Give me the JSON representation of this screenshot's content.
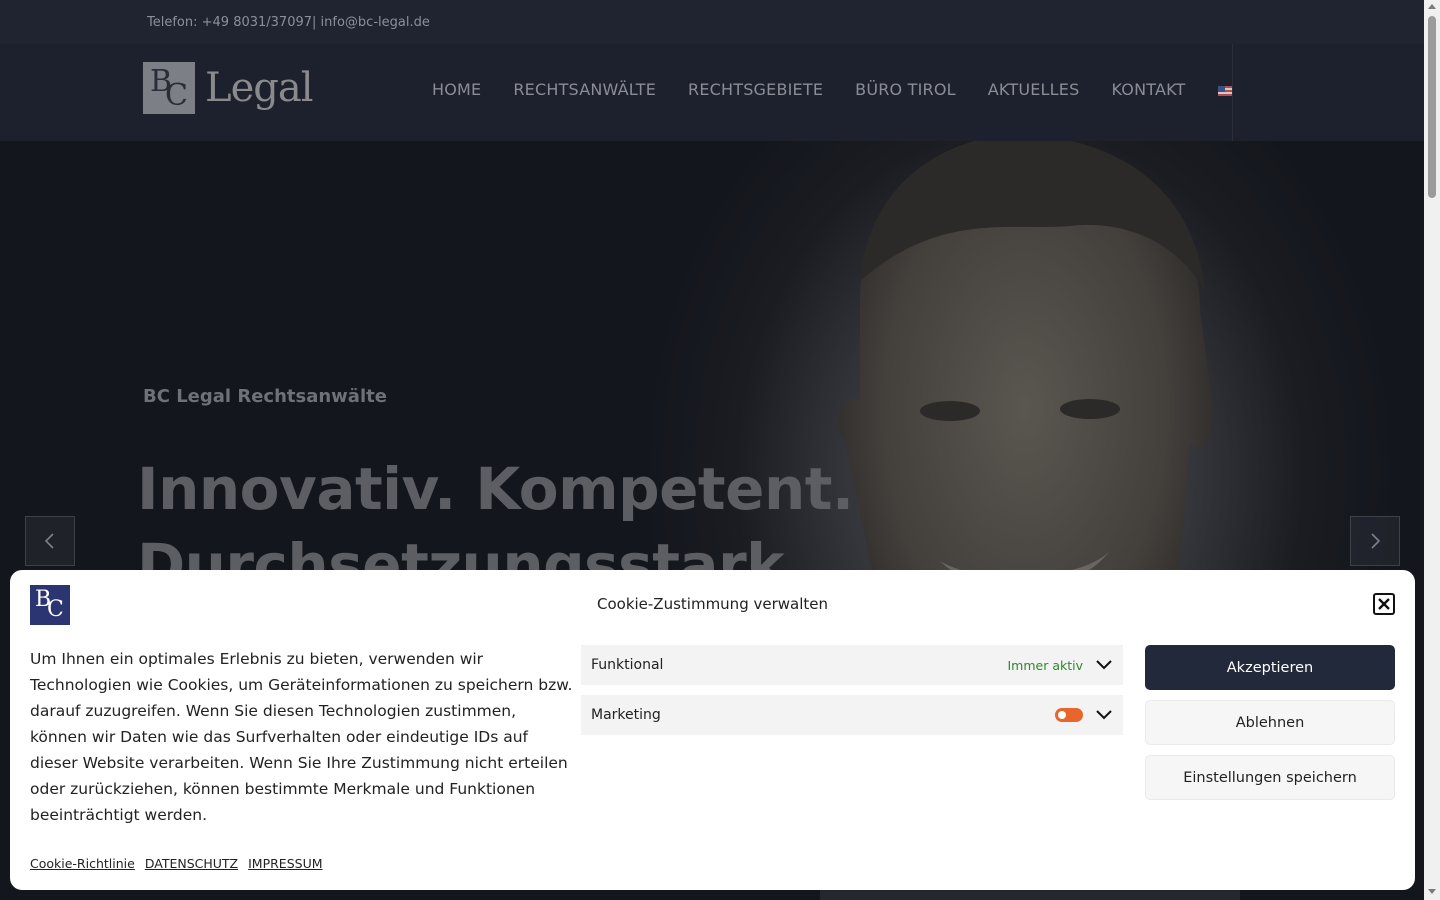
{
  "topbar": {
    "phone": "Telefon: +49 8031/37097",
    "separator": "|",
    "email": "info@bc-legal.de"
  },
  "logo": {
    "mark_b": "B",
    "mark_c": "C",
    "text": "Legal"
  },
  "nav": {
    "items": [
      {
        "label": "HOME"
      },
      {
        "label": "RECHTSANWÄLTE"
      },
      {
        "label": "RECHTSGEBIETE"
      },
      {
        "label": "BÜRO TIROL"
      },
      {
        "label": "AKTUELLES"
      },
      {
        "label": "KONTAKT"
      }
    ],
    "language_icon": "us-flag-icon"
  },
  "hero": {
    "kicker": "BC Legal Rechtsanwälte",
    "headline_line1": "Innovativ. Kompetent.",
    "headline_line2": "Durchsetzungsstark"
  },
  "cookie": {
    "title": "Cookie-Zustimmung verwalten",
    "text": "Um Ihnen ein optimales Erlebnis zu bieten, verwenden wir Technologien wie Cookies, um Geräteinformationen zu speichern bzw. darauf zuzugreifen. Wenn Sie diesen Technologien zustimmen, können wir Daten wie das Surfverhalten oder eindeutige IDs auf dieser Website verarbeiten. Wenn Sie Ihre Zustimmung nicht erteilen oder zurückziehen, können bestimmte Merkmale und Funktionen beeinträchtigt werden.",
    "categories": [
      {
        "label": "Funktional",
        "status": "Immer aktiv"
      },
      {
        "label": "Marketing",
        "enabled": true
      }
    ],
    "buttons": {
      "accept": "Akzeptieren",
      "deny": "Ablehnen",
      "save": "Einstellungen speichern"
    },
    "links": [
      "Cookie-Richtlinie",
      "DATENSCHUTZ",
      "IMPRESSUM"
    ],
    "toggle_color": "#e8662c",
    "accept_color": "#22293a"
  }
}
